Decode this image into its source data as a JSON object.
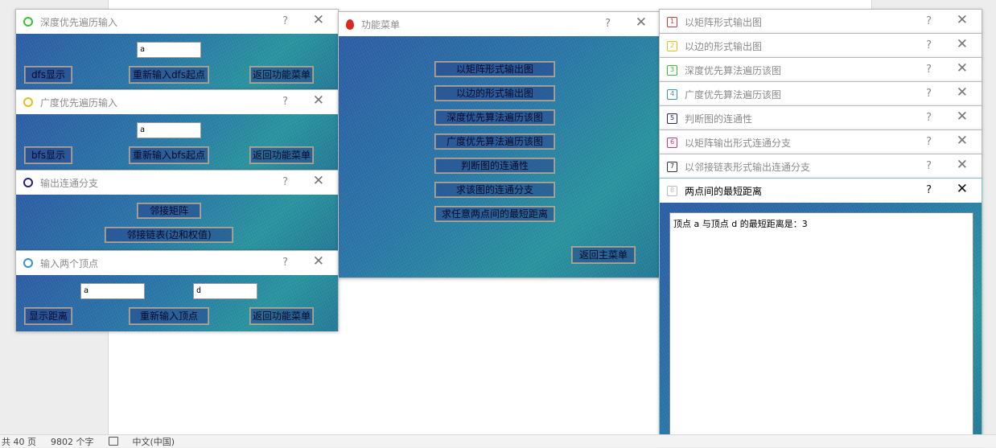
{
  "statusbar": {
    "pages": "共 40 页",
    "words": "9802 个字",
    "lang": "中文(中国)"
  },
  "dfs_window": {
    "title": "深度优先遍历输入",
    "help": "?",
    "close": "✕",
    "input_value": "a",
    "btn_show": "dfs显示",
    "btn_reinput": "重新输入dfs起点",
    "btn_back": "返回功能菜单"
  },
  "bfs_window": {
    "title": "广度优先遍历输入",
    "help": "?",
    "close": "✕",
    "input_value": "a",
    "btn_show": "bfs显示",
    "btn_reinput": "重新输入bfs起点",
    "btn_back": "返回功能菜单"
  },
  "component_window": {
    "title": "输出连通分支",
    "help": "?",
    "close": "✕",
    "btn_matrix": "邻接矩阵",
    "btn_list": "邻接链表(边和权值)"
  },
  "vertex_window": {
    "title": "输入两个顶点",
    "help": "?",
    "close": "✕",
    "input_a": "a",
    "input_b": "d",
    "btn_show": "显示距离",
    "btn_reinput": "重新输入顶点",
    "btn_back": "返回功能菜单"
  },
  "menu_window": {
    "title": "功能菜单",
    "help": "?",
    "close": "✕",
    "items": [
      "以矩阵形式输出图",
      "以边的形式输出图",
      "深度优先算法遍历该图",
      "广度优先算法遍历该图",
      "判断图的连通性",
      "求该图的连通分支",
      "求任意两点间的最短距离"
    ],
    "btn_back": "返回主菜单"
  },
  "stacked_windows": [
    {
      "num": "1",
      "title": "以矩阵形式输出图",
      "color": "#d23a3a"
    },
    {
      "num": "2",
      "title": "以边的形式输出图",
      "color": "#e3c31c"
    },
    {
      "num": "3",
      "title": "深度优先算法遍历该图",
      "color": "#3cb83c"
    },
    {
      "num": "4",
      "title": "广度优先算法遍历该图",
      "color": "#3a8fd2"
    },
    {
      "num": "5",
      "title": "判断图的连通性",
      "color": "#22227a"
    },
    {
      "num": "6",
      "title": "以矩阵输出形式连通分支",
      "color": "#d2347a"
    },
    {
      "num": "7",
      "title": "以邻接链表形式输出连通分支",
      "color": "#333333"
    }
  ],
  "stacked_help": "?",
  "stacked_close": "✕",
  "distance_window": {
    "num": "8",
    "title": "两点间的最短距离",
    "help": "?",
    "close": "✕",
    "result": "顶点 a 与顶点 d 的最短距离是：3"
  }
}
